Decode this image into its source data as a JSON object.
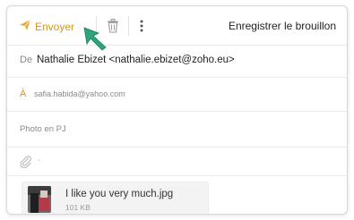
{
  "toolbar": {
    "send_label": "Envoyer",
    "save_draft_label": "Enregistrer le brouillon",
    "send_icon": "send-icon",
    "trash_icon": "trash-icon",
    "more_icon": "more-vertical-icon"
  },
  "compose": {
    "from_label": "De",
    "from_value": "Nathalie Ebizet <nathalie.ebizet@zoho.eu>",
    "to_label": "À",
    "to_value": "safia.habida@yahoo.com",
    "subject_value": "Photo en PJ",
    "attach_icon": "paperclip-icon",
    "attach_placeholder": "-"
  },
  "attachment": {
    "filename": "I like you very much.jpg",
    "filesize": "101 KB"
  },
  "colors": {
    "accent": "#d9961a",
    "cursor": "#2fa37a"
  }
}
